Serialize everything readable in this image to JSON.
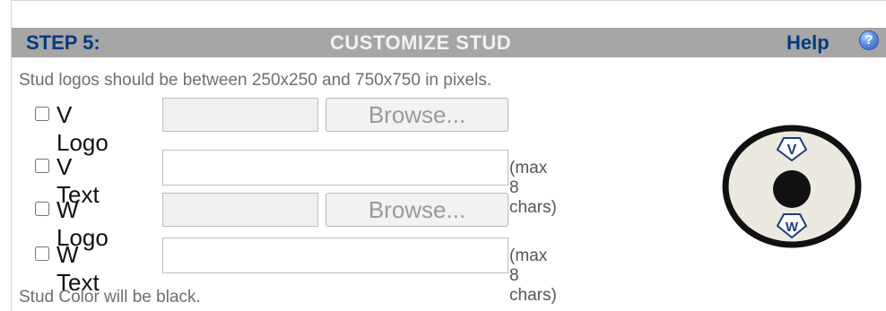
{
  "header": {
    "step_label": "STEP 5:",
    "title": "CUSTOMIZE STUD",
    "help_label": "Help",
    "help_icon_glyph": "?"
  },
  "notes": {
    "size_note": "Stud logos should be between 250x250 and 750x750 in pixels.",
    "color_note": "Stud Color will be black."
  },
  "rows": [
    {
      "label": "V Logo",
      "type": "file",
      "button_label": "Browse..."
    },
    {
      "label": "V Text",
      "type": "text",
      "value": "",
      "hint": "(max 8 chars)"
    },
    {
      "label": "W Logo",
      "type": "file",
      "button_label": "Browse..."
    },
    {
      "label": "W Text",
      "type": "text",
      "value": "",
      "hint": "(max 8 chars)"
    }
  ],
  "preview": {
    "top_badge": "V",
    "bottom_badge": "W"
  },
  "colors": {
    "header_bg": "#a6a6a6",
    "step_blue": "#003a80",
    "title_text": "#f2f2f2",
    "note_text": "#6f6f6f",
    "stud_fill": "#ece9e1",
    "stud_center": "#111111"
  },
  "icons": [
    "help-icon",
    "checkbox",
    "stud-preview"
  ]
}
